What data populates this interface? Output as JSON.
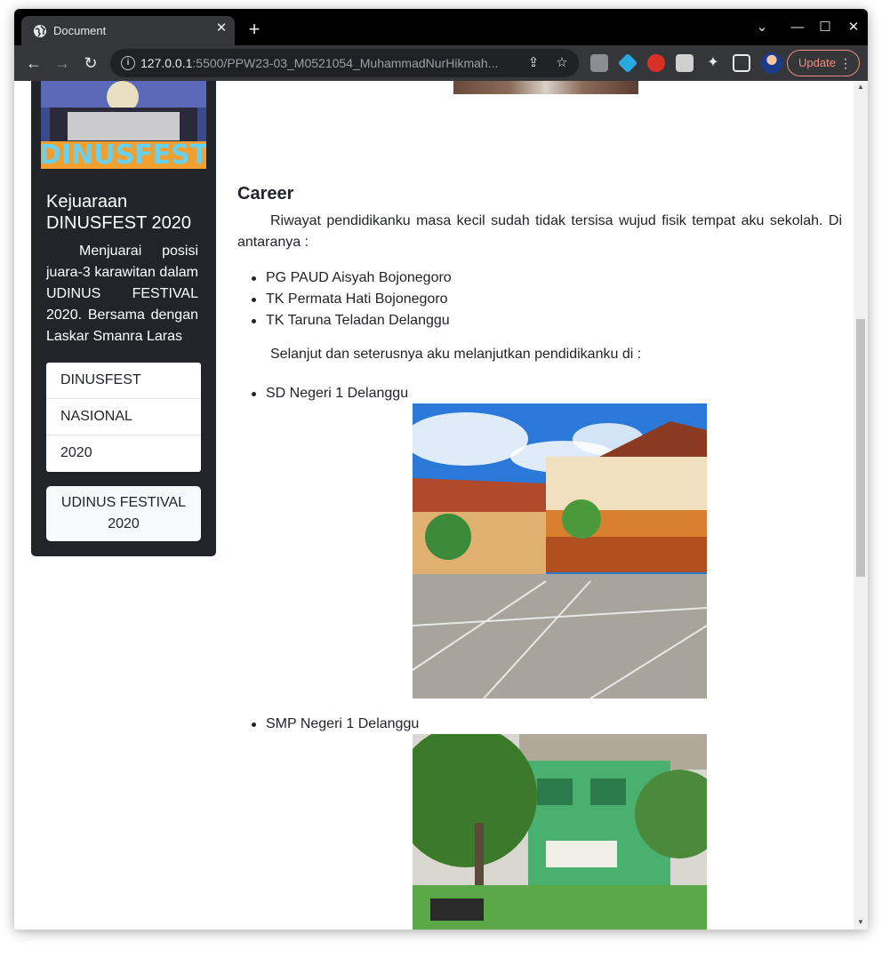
{
  "browser": {
    "tab_title": "Document",
    "tab_close": "✕",
    "new_tab": "+",
    "url_host": "127.0.0.1",
    "url_path": ":5500/PPW23-03_M0521054_MuhammadNurHikmah...",
    "update_label": "Update"
  },
  "sidebar": {
    "image_text": "DINUSFEST",
    "title": "Kejuaraan DINUSFEST 2020",
    "text": "Menjuarai posisi juara-3 karawitan dalam UDINUS FESTIVAL 2020. Bersama dengan Laskar Smanra Laras",
    "items": [
      {
        "label": "DINUSFEST"
      },
      {
        "label": "NASIONAL"
      },
      {
        "label": "2020"
      }
    ],
    "button_label": "UDINUS FESTIVAL 2020"
  },
  "main": {
    "section_title": "Career",
    "intro": "Riwayat pendidikanku masa kecil sudah tidak tersisa wujud fisik tempat aku sekolah. Di antaranya :",
    "early_schools": [
      "PG PAUD Aisyah Bojonegoro",
      "TK Permata Hati Bojonegoro",
      "TK Taruna Teladan Delanggu"
    ],
    "continue_text": "Selanjut dan seterusnya aku melanjutkan pendidikanku di :",
    "schools": [
      {
        "name": "SD Negeri 1 Delanggu"
      },
      {
        "name": "SMP Negeri 1 Delanggu"
      }
    ]
  }
}
